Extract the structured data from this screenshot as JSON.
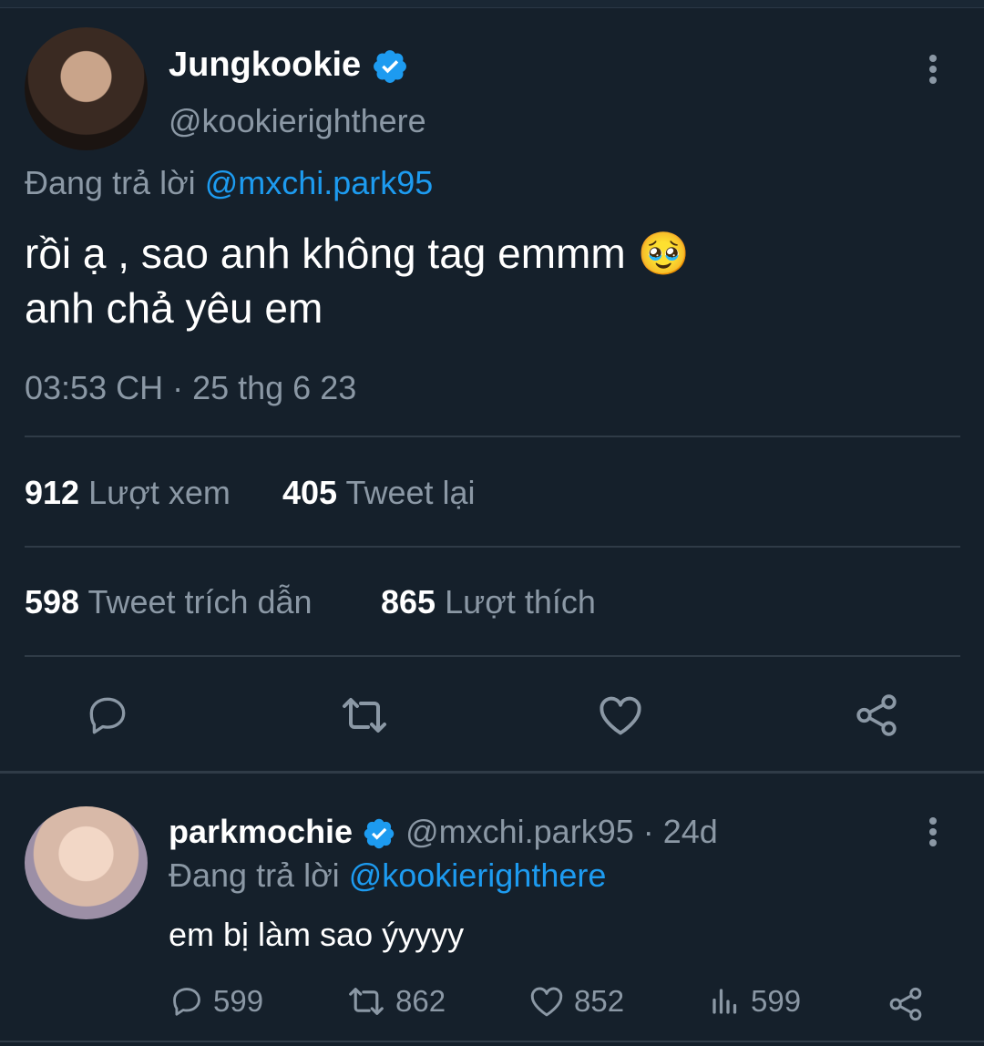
{
  "main_tweet": {
    "display_name": "Jungkookie",
    "handle": "@kookierighthere",
    "reply_prefix": "Đang trả lời",
    "reply_to": "@mxchi.park95",
    "text_line1": "rồi ạ , sao anh không tag emmm",
    "emoji": "🥹",
    "text_line2": "anh chả yêu em",
    "timestamp": "03:53 CH · 25 thg 6 23",
    "stats": {
      "views_count": "912",
      "views_label": "Lượt xem",
      "retweets_count": "405",
      "retweets_label": "Tweet lại",
      "quotes_count": "598",
      "quotes_label": "Tweet trích dẫn",
      "likes_count": "865",
      "likes_label": "Lượt thích"
    },
    "actions": [
      "reply-icon",
      "retweet-icon",
      "like-icon",
      "share-icon"
    ]
  },
  "reply_tweet": {
    "display_name": "parkmochie",
    "handle_time": "@mxchi.park95 · 24d",
    "reply_prefix": "Đang trả lời",
    "reply_to": "@kookierighthere",
    "text": "em bị làm sao ýyyyy",
    "counts": {
      "replies": "599",
      "retweets": "862",
      "likes": "852",
      "views": "599"
    }
  },
  "colors": {
    "background": "#15202b",
    "accent": "#1d9bf0",
    "muted": "#8b98a5",
    "divider": "#2f3b47"
  }
}
